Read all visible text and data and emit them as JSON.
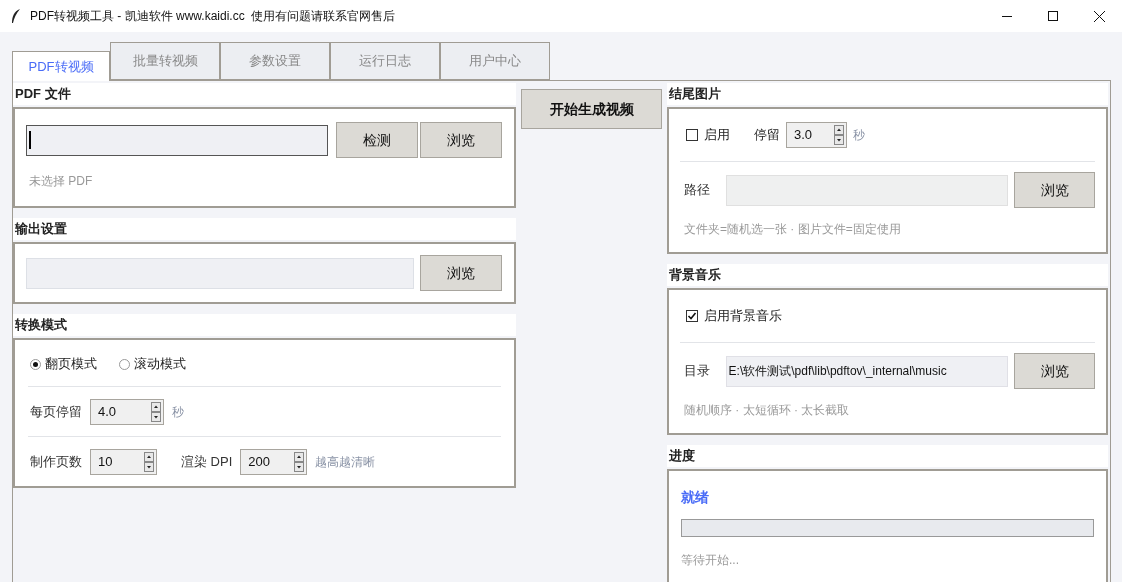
{
  "window": {
    "title": "PDF转视频工具 - 凯迪软件 www.kaidi.cc  使用有问题请联系官网售后"
  },
  "tabs": [
    {
      "label": "PDF转视频",
      "selected": true
    },
    {
      "label": "批量转视频",
      "selected": false
    },
    {
      "label": "参数设置",
      "selected": false
    },
    {
      "label": "运行日志",
      "selected": false
    },
    {
      "label": "用户中心",
      "selected": false
    }
  ],
  "pdf_file": {
    "title": "PDF 文件",
    "detect_button": "检测",
    "browse_button": "浏览",
    "status": "未选择 PDF"
  },
  "output": {
    "title": "输出设置",
    "browse_button": "浏览"
  },
  "mode": {
    "title": "转换模式",
    "radios": [
      {
        "label": "翻页模式",
        "selected": true
      },
      {
        "label": "滚动模式",
        "selected": false
      }
    ],
    "per_page": {
      "label": "每页停留",
      "value": "4.0",
      "unit": "秒"
    },
    "pages": {
      "label": "制作页数",
      "value": "10"
    },
    "dpi": {
      "label": "渲染 DPI",
      "value": "200",
      "hint": "越高越清晰"
    }
  },
  "start_button": "开始生成视频",
  "end_image": {
    "title": "结尾图片",
    "enable": {
      "label": "启用",
      "checked": false
    },
    "stay": {
      "label": "停留",
      "value": "3.0",
      "unit": "秒"
    },
    "path": {
      "label": "路径",
      "browse_button": "浏览"
    },
    "hint": "文件夹=随机选一张 · 图片文件=固定使用"
  },
  "bg_music": {
    "title": "背景音乐",
    "enable": {
      "label": "启用背景音乐",
      "checked": true
    },
    "dir": {
      "label": "目录",
      "value": "E:\\软件测试\\pdf\\lib\\pdftov\\_internal\\music",
      "browse_button": "浏览"
    },
    "hint": "随机顺序 · 太短循环 · 太长截取"
  },
  "progress": {
    "title": "进度",
    "status": "就绪",
    "level": 0,
    "message": "等待开始..."
  }
}
